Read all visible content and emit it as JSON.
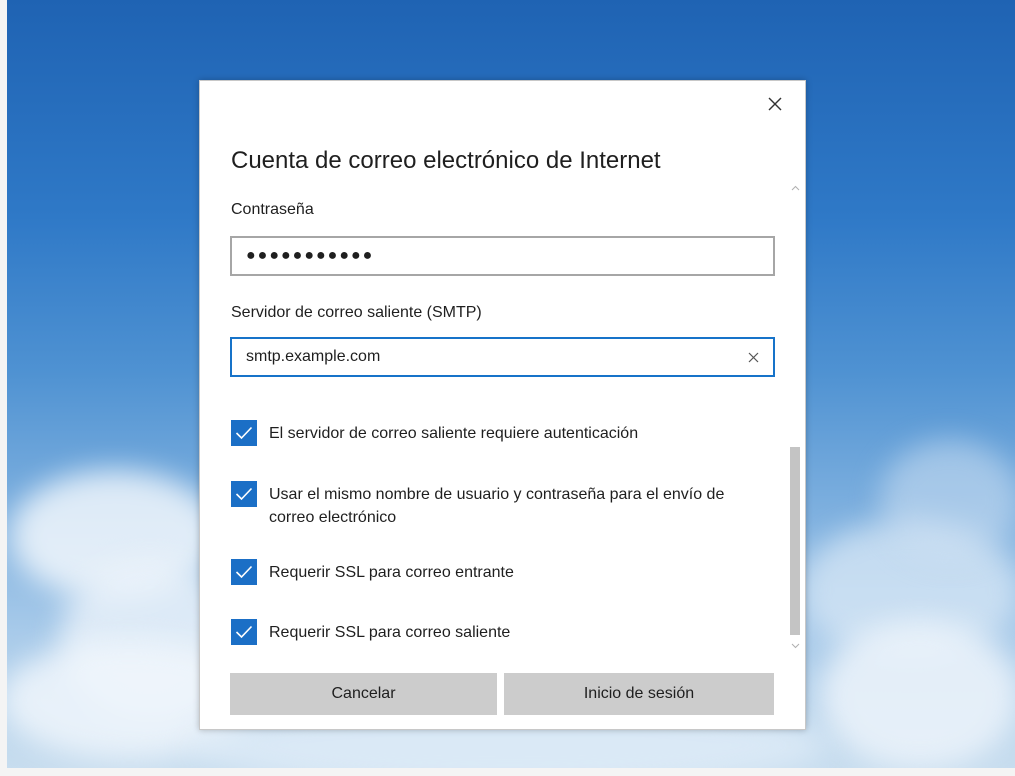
{
  "dialog": {
    "title": "Cuenta de correo electrónico de Internet",
    "close_icon": "close-icon"
  },
  "password": {
    "label": "Contraseña",
    "value": "●●●●●●●●●●●"
  },
  "smtp": {
    "label": "Servidor de correo saliente (SMTP)",
    "value": "smtp.example.com",
    "clear_icon": "clear-icon"
  },
  "checkboxes": [
    {
      "label": "El servidor de correo saliente requiere autenticación",
      "checked": true
    },
    {
      "label": "Usar el mismo nombre de usuario y contraseña para el envío de correo electrónico",
      "checked": true
    },
    {
      "label": "Requerir SSL para correo entrante",
      "checked": true
    },
    {
      "label": "Requerir SSL para correo saliente",
      "checked": true
    }
  ],
  "buttons": {
    "cancel_label": "Cancelar",
    "signin_label": "Inicio de sesión"
  },
  "colors": {
    "accent": "#1b6fc6",
    "focus_border": "#1773c9",
    "button_bg": "#cccccc"
  }
}
